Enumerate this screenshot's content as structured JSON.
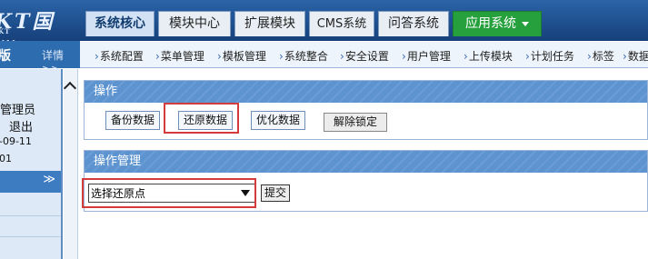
{
  "header": {
    "logo_text": "KT国微",
    "logo_subtext": "KT",
    "tabs": [
      {
        "label": "系统核心",
        "active": true
      },
      {
        "label": "模块中心",
        "active": false
      },
      {
        "label": "扩展模块",
        "active": false
      },
      {
        "label": "CMS系统",
        "active": false
      },
      {
        "label": "问答系统",
        "active": false
      },
      {
        "label": "应用系统",
        "active": false
      }
    ],
    "colors": {
      "bar": "#1e4e8c",
      "active_tab": "#d2e2f4",
      "app_tab": "#26a03c"
    }
  },
  "sidebar": {
    "header_title": "版",
    "details_link": "详情>>",
    "user_lines": [
      "管理员",
      "退出",
      "-09-11",
      "01"
    ],
    "menu_head_icon": "double-chevron-down-icon"
  },
  "subnav": {
    "items": [
      "系统配置",
      "菜单管理",
      "模板管理",
      "系统整合",
      "安全设置",
      "用户管理",
      "上传模块",
      "计划任务",
      "标签",
      "数据"
    ]
  },
  "panel_operations": {
    "title": "操作",
    "buttons": [
      "备份数据",
      "还原数据",
      "优化数据",
      "解除锁定"
    ]
  },
  "panel_manage": {
    "title": "操作管理",
    "select_value": "选择还原点",
    "submit_label": "提交"
  }
}
